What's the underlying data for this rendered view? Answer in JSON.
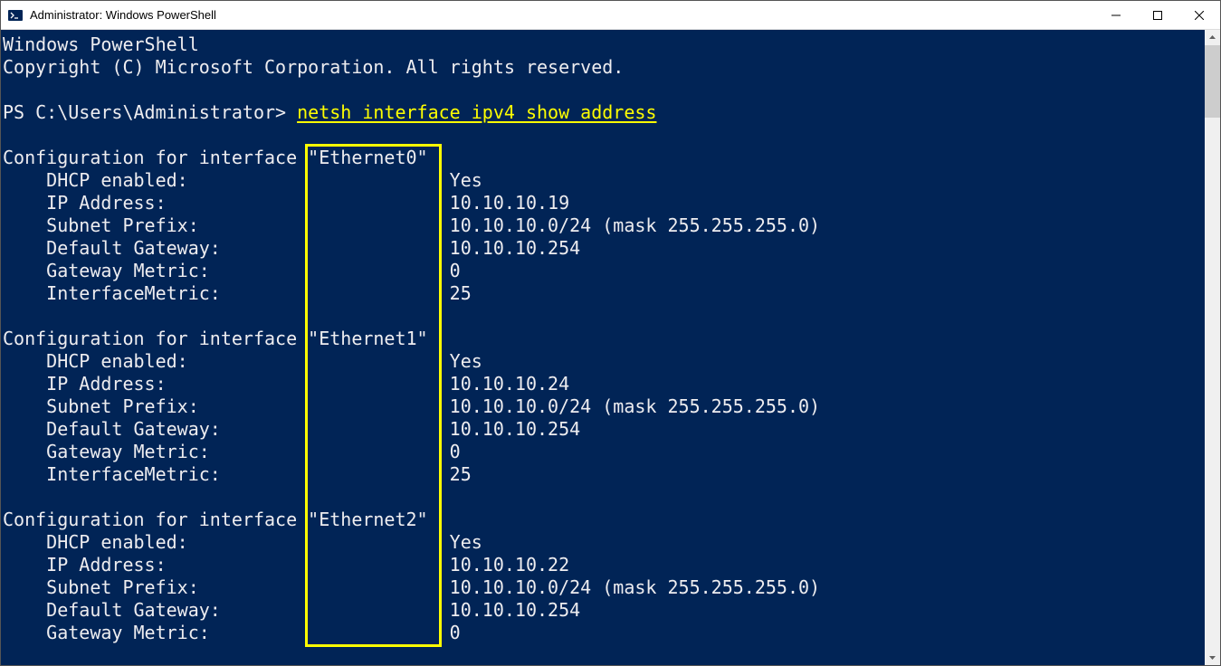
{
  "window": {
    "title": "Administrator: Windows PowerShell"
  },
  "terminal": {
    "banner_line1": "Windows PowerShell",
    "banner_line2": "Copyright (C) Microsoft Corporation. All rights reserved.",
    "prompt": "PS C:\\Users\\Administrator> ",
    "command": "netsh interface ipv4 show address",
    "interfaces": [
      {
        "header_prefix": "Configuration for interface ",
        "name": "\"Ethernet0\"",
        "rows": [
          {
            "label": "    DHCP enabled:",
            "value": "Yes"
          },
          {
            "label": "    IP Address:",
            "value": "10.10.10.19"
          },
          {
            "label": "    Subnet Prefix:",
            "value": "10.10.10.0/24 (mask 255.255.255.0)"
          },
          {
            "label": "    Default Gateway:",
            "value": "10.10.10.254"
          },
          {
            "label": "    Gateway Metric:",
            "value": "0"
          },
          {
            "label": "    InterfaceMetric:",
            "value": "25"
          }
        ]
      },
      {
        "header_prefix": "Configuration for interface ",
        "name": "\"Ethernet1\"",
        "rows": [
          {
            "label": "    DHCP enabled:",
            "value": "Yes"
          },
          {
            "label": "    IP Address:",
            "value": "10.10.10.24"
          },
          {
            "label": "    Subnet Prefix:",
            "value": "10.10.10.0/24 (mask 255.255.255.0)"
          },
          {
            "label": "    Default Gateway:",
            "value": "10.10.10.254"
          },
          {
            "label": "    Gateway Metric:",
            "value": "0"
          },
          {
            "label": "    InterfaceMetric:",
            "value": "25"
          }
        ]
      },
      {
        "header_prefix": "Configuration for interface ",
        "name": "\"Ethernet2\"",
        "rows": [
          {
            "label": "    DHCP enabled:",
            "value": "Yes"
          },
          {
            "label": "    IP Address:",
            "value": "10.10.10.22"
          },
          {
            "label": "    Subnet Prefix:",
            "value": "10.10.10.0/24 (mask 255.255.255.0)"
          },
          {
            "label": "    Default Gateway:",
            "value": "10.10.10.254"
          },
          {
            "label": "    Gateway Metric:",
            "value": "0"
          }
        ]
      }
    ],
    "label_col_width": 41
  },
  "annotations": {
    "highlight_box": {
      "top_line": 5,
      "height_lines": 22,
      "left_char": 28,
      "width_chars": 12.5
    }
  }
}
